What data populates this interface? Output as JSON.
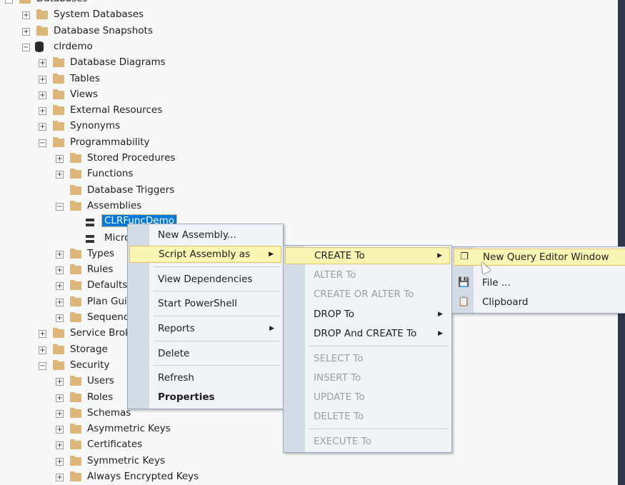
{
  "tree": [
    {
      "label": "Databases",
      "level": 0,
      "exp": "minus",
      "icon": "folder"
    },
    {
      "label": "System Databases",
      "level": 1,
      "exp": "plus",
      "icon": "folder"
    },
    {
      "label": "Database Snapshots",
      "level": 1,
      "exp": "plus",
      "icon": "folder"
    },
    {
      "label": "clrdemo",
      "level": 1,
      "exp": "minus",
      "icon": "db"
    },
    {
      "label": "Database Diagrams",
      "level": 2,
      "exp": "plus",
      "icon": "folder"
    },
    {
      "label": "Tables",
      "level": 2,
      "exp": "plus",
      "icon": "folder"
    },
    {
      "label": "Views",
      "level": 2,
      "exp": "plus",
      "icon": "folder"
    },
    {
      "label": "External Resources",
      "level": 2,
      "exp": "plus",
      "icon": "folder"
    },
    {
      "label": "Synonyms",
      "level": 2,
      "exp": "plus",
      "icon": "folder"
    },
    {
      "label": "Programmability",
      "level": 2,
      "exp": "minus",
      "icon": "folder"
    },
    {
      "label": "Stored Procedures",
      "level": 3,
      "exp": "plus",
      "icon": "folder"
    },
    {
      "label": "Functions",
      "level": 3,
      "exp": "plus",
      "icon": "folder"
    },
    {
      "label": "Database Triggers",
      "level": 3,
      "exp": "none",
      "icon": "folder"
    },
    {
      "label": "Assemblies",
      "level": 3,
      "exp": "minus",
      "icon": "folder"
    },
    {
      "label": "CLRFuncDemo",
      "level": 4,
      "exp": "none",
      "icon": "assembly",
      "selected": true
    },
    {
      "label": "Micro",
      "level": 4,
      "exp": "none",
      "icon": "assembly"
    },
    {
      "label": "Types",
      "level": 3,
      "exp": "plus",
      "icon": "folder"
    },
    {
      "label": "Rules",
      "level": 3,
      "exp": "plus",
      "icon": "folder"
    },
    {
      "label": "Defaults",
      "level": 3,
      "exp": "plus",
      "icon": "folder"
    },
    {
      "label": "Plan Gui",
      "level": 3,
      "exp": "plus",
      "icon": "folder"
    },
    {
      "label": "Sequenc",
      "level": 3,
      "exp": "plus",
      "icon": "folder"
    },
    {
      "label": "Service Brok",
      "level": 2,
      "exp": "plus",
      "icon": "folder"
    },
    {
      "label": "Storage",
      "level": 2,
      "exp": "plus",
      "icon": "folder"
    },
    {
      "label": "Security",
      "level": 2,
      "exp": "minus",
      "icon": "folder"
    },
    {
      "label": "Users",
      "level": 3,
      "exp": "plus",
      "icon": "folder"
    },
    {
      "label": "Roles",
      "level": 3,
      "exp": "plus",
      "icon": "folder"
    },
    {
      "label": "Schemas",
      "level": 3,
      "exp": "plus",
      "icon": "folder"
    },
    {
      "label": "Asymmetric Keys",
      "level": 3,
      "exp": "plus",
      "icon": "folder"
    },
    {
      "label": "Certificates",
      "level": 3,
      "exp": "plus",
      "icon": "folder"
    },
    {
      "label": "Symmetric Keys",
      "level": 3,
      "exp": "plus",
      "icon": "folder"
    },
    {
      "label": "Always Encrypted Keys",
      "level": 3,
      "exp": "plus",
      "icon": "folder"
    }
  ],
  "context_menu": {
    "items": [
      "New Assembly...",
      "Script Assembly as",
      "View Dependencies",
      "Start PowerShell",
      "Reports",
      "Delete",
      "Refresh",
      "Properties"
    ]
  },
  "script_menu": {
    "items": [
      "CREATE To",
      "ALTER To",
      "CREATE OR ALTER To",
      "DROP To",
      "DROP And CREATE To",
      "SELECT To",
      "INSERT To",
      "UPDATE To",
      "DELETE To",
      "EXECUTE To"
    ]
  },
  "create_menu": {
    "items": [
      "New Query Editor Window",
      "File ...",
      "Clipboard"
    ],
    "icons": [
      "query-window-icon",
      "save-file-icon",
      "clipboard-icon"
    ]
  },
  "colors": {
    "selection": "#0078d7",
    "highlight": "#fbf5b4"
  }
}
